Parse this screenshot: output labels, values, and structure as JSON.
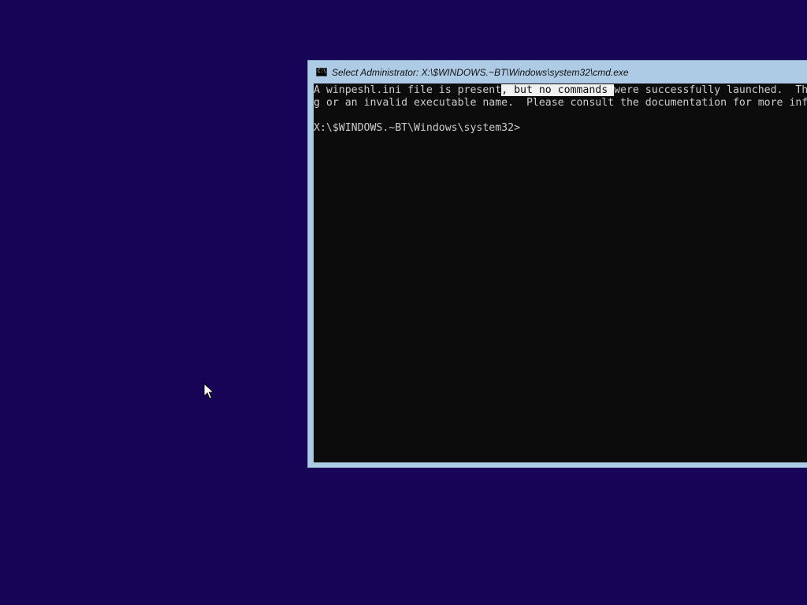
{
  "window": {
    "title": "Select Administrator: X:\\$WINDOWS.~BT\\Windows\\system32\\cmd.exe",
    "icon": "console-icon"
  },
  "console": {
    "line1": {
      "before": "A winpeshl.ini file is present",
      "selected": ", but no commands ",
      "after": "were successfully launched.  Th"
    },
    "line2": "g or an invalid executable name.  Please consult the documentation for more inf",
    "line3": "",
    "prompt": "X:\\$WINDOWS.~BT\\Windows\\system32>"
  },
  "colors": {
    "desktop_background": "#180457",
    "console_background": "#0c0c0c",
    "console_text": "#cccccc",
    "window_frame": "#aecbe6"
  },
  "cursor": {
    "icon": "mouse-pointer-icon"
  }
}
